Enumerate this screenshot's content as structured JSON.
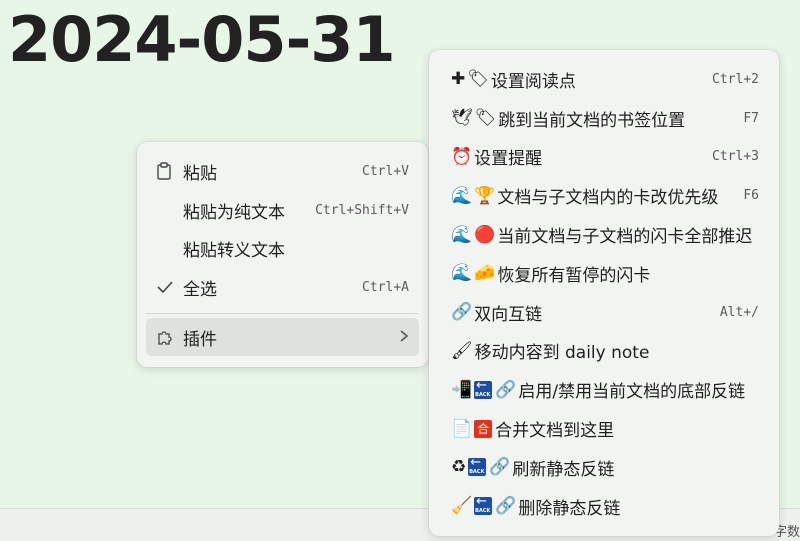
{
  "document": {
    "title": "2024-05-31"
  },
  "status_bar": {
    "text": "字数"
  },
  "context_menu": {
    "items": [
      {
        "label": "粘贴",
        "shortcut": "Ctrl+V",
        "icon": "clipboard-icon"
      },
      {
        "label": "粘贴为纯文本",
        "shortcut": "Ctrl+Shift+V"
      },
      {
        "label": "粘贴转义文本"
      },
      {
        "label": "全选",
        "shortcut": "Ctrl+A",
        "icon": "check-icon"
      },
      {
        "label": "插件",
        "icon": "puzzle-icon",
        "submenu_icon": "chevron-right-icon"
      }
    ]
  },
  "plugin_menu": {
    "items": [
      {
        "label": "设置阅读点",
        "shortcut": "Ctrl+2",
        "icons": [
          "cross-icon",
          "label-tag-icon"
        ]
      },
      {
        "label": "跳到当前文档的书签位置",
        "shortcut": "F7",
        "icons": [
          "dove-icon",
          "label-tag-icon"
        ]
      },
      {
        "label": "设置提醒",
        "shortcut": "Ctrl+3",
        "icons": [
          "alarm-clock-icon"
        ]
      },
      {
        "label": "文档与子文档内的卡改优先级",
        "shortcut": "F6",
        "icons": [
          "wave-icon",
          "trophy-icon"
        ]
      },
      {
        "label": "当前文档与子文档的闪卡全部推迟",
        "icons": [
          "wave-icon",
          "red-circle-icon"
        ]
      },
      {
        "label": "恢复所有暂停的闪卡",
        "icons": [
          "wave-icon",
          "cheese-icon"
        ]
      },
      {
        "label": "双向互链",
        "shortcut": "Alt+/",
        "icons": [
          "link-icon"
        ]
      },
      {
        "label": "移动内容到 daily note",
        "icons": [
          "brush-icon"
        ]
      },
      {
        "label": "启用/禁用当前文档的底部反链",
        "icons": [
          "phone-icon",
          "back-arrow-icon",
          "link-icon"
        ]
      },
      {
        "label": "合并文档到这里",
        "icons": [
          "page-icon",
          "he-button-icon"
        ]
      },
      {
        "label": "刷新静态反链",
        "icons": [
          "recycle-icon",
          "back-arrow-icon",
          "link-icon"
        ]
      },
      {
        "label": "删除静态反链",
        "icons": [
          "broom-icon",
          "back-arrow-icon",
          "link-icon"
        ]
      }
    ]
  }
}
